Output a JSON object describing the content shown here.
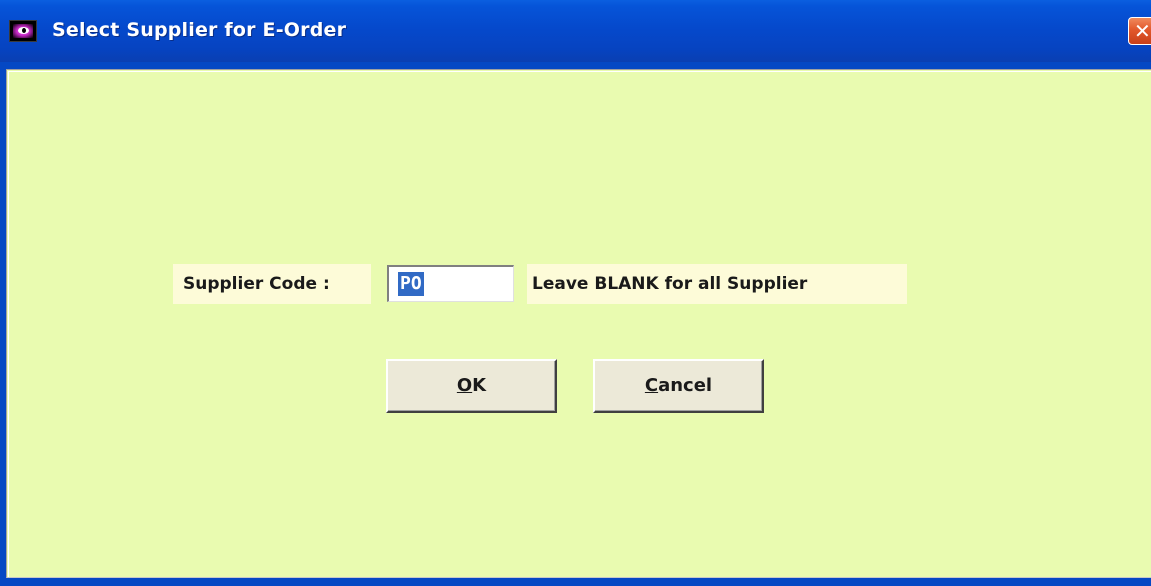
{
  "window": {
    "title": "Select Supplier for E-Order",
    "close_glyph": "✕",
    "app_icon": "eye-app-icon"
  },
  "form": {
    "supplier_label": "Supplier Code :",
    "supplier_value": "PO",
    "hint": "Leave BLANK for all Supplier"
  },
  "buttons": {
    "ok": {
      "mnemonic": "O",
      "rest": "K"
    },
    "cancel": {
      "mnemonic": "C",
      "rest": "ancel"
    }
  },
  "colors": {
    "client_bg": "#e9fbb0",
    "label_bg": "#fdfbd8",
    "titlebar": "#0549cc",
    "selection": "#316ac5"
  }
}
